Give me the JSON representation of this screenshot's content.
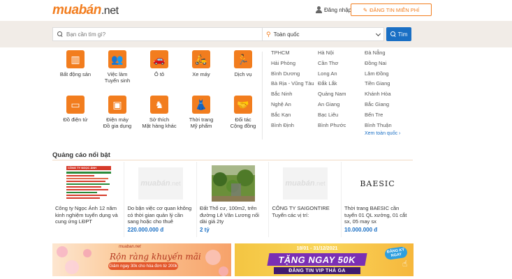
{
  "header": {
    "logo_part1": "muabán",
    "logo_part2": ".net",
    "login_label": "Đăng nhập",
    "post_button_label": "ĐĂNG TIN MIỄN PHÍ"
  },
  "search": {
    "placeholder": "Bạn cần tìm gì?",
    "location_value": "Toàn quốc",
    "button_label": "Tìm"
  },
  "categories": [
    {
      "label": "Bất động sản",
      "icon": "building-icon"
    },
    {
      "label": "Việc làm\nTuyển sinh",
      "icon": "people-icon"
    },
    {
      "label": "Ô tô",
      "icon": "car-icon"
    },
    {
      "label": "Xe máy",
      "icon": "scooter-icon"
    },
    {
      "label": "Dịch vụ",
      "icon": "runner-icon"
    },
    {
      "label": "Đồ điện tử",
      "icon": "devices-icon"
    },
    {
      "label": "Điện máy\nĐồ gia dụng",
      "icon": "washing-machine-icon"
    },
    {
      "label": "Sở thích\nMặt hàng khác",
      "icon": "rocking-horse-icon"
    },
    {
      "label": "Thời trang\nMỹ phẩm",
      "icon": "fashion-icon"
    },
    {
      "label": "Đối tác\nCộng đồng",
      "icon": "handshake-icon"
    }
  ],
  "cities": [
    [
      "TPHCM",
      "Hà Nội",
      "Đà Nẵng"
    ],
    [
      "Hải Phòng",
      "Cần Thơ",
      "Đồng Nai"
    ],
    [
      "Bình Dương",
      "Long An",
      "Lâm Đồng"
    ],
    [
      "Bà Rịa - Vũng Tàu",
      "Đắk Lắk",
      "Tiền Giang"
    ],
    [
      "Bắc Ninh",
      "Quảng Nam",
      "Khánh Hòa"
    ],
    [
      "Nghệ An",
      "An Giang",
      "Bắc Giang"
    ],
    [
      "Bắc Kạn",
      "Bạc Liêu",
      "Bến Tre"
    ],
    [
      "Bình Định",
      "Bình Phước",
      "Bình Thuận"
    ]
  ],
  "more_cities_label": "Xem toàn quốc",
  "featured": {
    "title": "Quảng cáo nổi bật",
    "cards": [
      {
        "title": "Công ty Ngọc Ánh 12 năm kinh nghiệm tuyển dụng và cung ứng LĐPT",
        "price": "",
        "image": "flyer",
        "image_text": "CÔNG TY NGỌC ÁNH"
      },
      {
        "title": "Do bận việc cơ quan không có thời gian quản lý cần sang hoặc cho thuê",
        "price": "220.000.000 đ",
        "image": "placeholder"
      },
      {
        "title": "Đất Thổ cư, 100m2, trên đường Lê Văn Lương nối dài giá 2ty",
        "price": "2 tỷ",
        "image": "photo"
      },
      {
        "title": "CÔNG TY SAIGONTIRE Tuyển các vị trí:",
        "price": "",
        "image": "placeholder"
      },
      {
        "title": "Thời trang BAESIC cần tuyển 01 QL xưởng, 01 cắt sx, 05 may sx",
        "price": "10.000.000 đ",
        "image": "brand",
        "image_text": "BAESIC"
      }
    ]
  },
  "banners": {
    "left": {
      "kicker": "muaban.net",
      "headline": "Rộn ràng khuyến mãi",
      "sub": "Giảm ngay 30k cho hóa đơn từ 200k"
    },
    "right": {
      "date": "18/01 - 31/12/2021",
      "headline": "TẶNG NGAY 50K",
      "sub": "ĐĂNG TIN VIP THẢ GA",
      "cta": "ĐĂNG KÝ NGAY"
    }
  },
  "colors": {
    "brand_orange": "#f27d1e",
    "link_blue": "#1a6fc4",
    "search_band": "#f1ece7"
  }
}
